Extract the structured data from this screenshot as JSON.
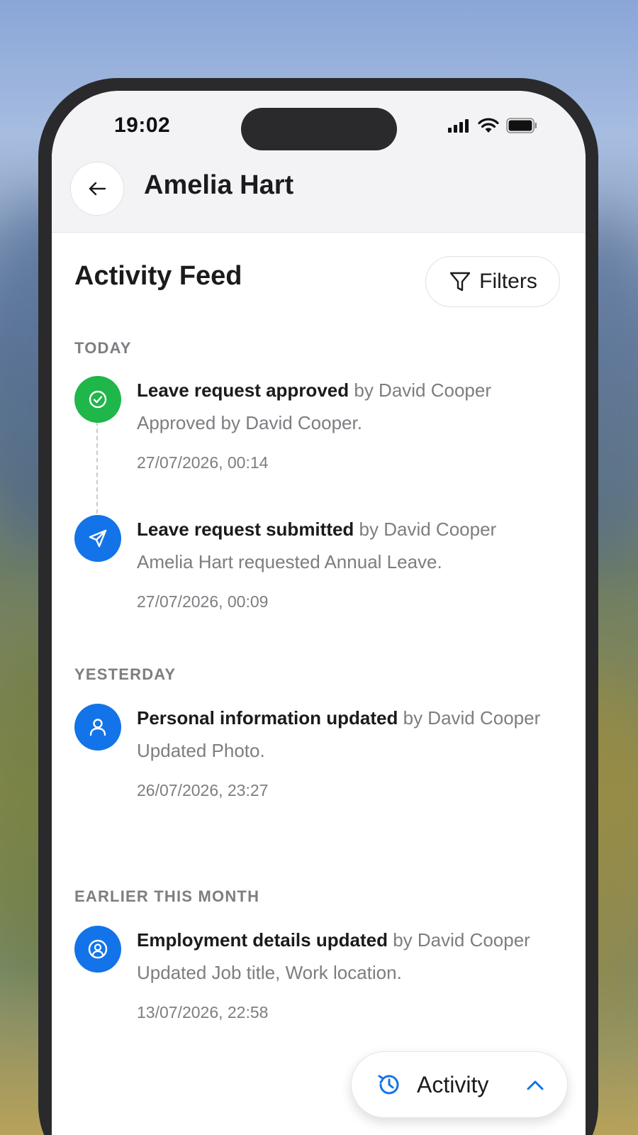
{
  "status_bar": {
    "time": "19:02"
  },
  "header": {
    "person_name": "Amelia Hart"
  },
  "feed": {
    "title": "Activity Feed",
    "filters_label": "Filters",
    "sections": [
      {
        "label": "TODAY",
        "items": [
          {
            "icon": "check-circle-icon",
            "color": "#1fb64a",
            "action": "Leave request approved",
            "by": "by David Cooper",
            "description": "Approved by David Cooper.",
            "date": "27/07/2026, 00:14"
          },
          {
            "icon": "send-icon",
            "color": "#1274e8",
            "action": "Leave request submitted",
            "by": "by David Cooper",
            "description": "Amelia Hart requested Annual Leave.",
            "date": "27/07/2026, 00:09"
          }
        ]
      },
      {
        "label": "YESTERDAY",
        "items": [
          {
            "icon": "user-icon",
            "color": "#1274e8",
            "action": "Personal information updated",
            "by": "by David Cooper",
            "description": "Updated Photo.",
            "date": "26/07/2026, 23:27"
          }
        ]
      },
      {
        "label": "EARLIER THIS MONTH",
        "items": [
          {
            "icon": "user-circle-icon",
            "color": "#1274e8",
            "action": "Employment details updated",
            "by": "by David Cooper",
            "description": "Updated Job title, Work location.",
            "date": "13/07/2026, 22:58"
          }
        ]
      }
    ]
  },
  "activity_pill": {
    "label": "Activity",
    "icon": "history-icon",
    "accent": "#1274e8"
  }
}
